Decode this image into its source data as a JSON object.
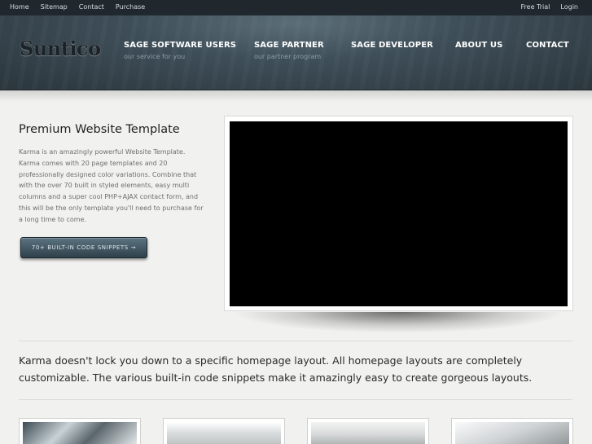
{
  "topbar": {
    "left_links": [
      "Home",
      "Sitemap",
      "Contact",
      "Purchase"
    ],
    "right_links": [
      "Free Trial",
      "Login"
    ]
  },
  "header": {
    "logo": "Suntico",
    "nav": [
      {
        "label": "SAGE SOFTWARE USERS",
        "sub": "our service for you"
      },
      {
        "label": "SAGE PARTNER",
        "sub": "our partner program"
      },
      {
        "label": "SAGE DEVELOPER",
        "sub": ""
      },
      {
        "label": "ABOUT US",
        "sub": ""
      },
      {
        "label": "CONTACT",
        "sub": ""
      }
    ]
  },
  "hero": {
    "title": "Premium Website Template",
    "body": "Karma is an amazingly powerful Website Template. Karma comes with 20 page templates and 20 professionally designed color variations. Combine that with the over 70 built in styled elements, easy multi columns and a super cool PHP+AJAX contact form, and this will be the only template you'll need to purchase for a long time to come.",
    "button_label": "70+ BUILT-IN CODE SNIPPETS →"
  },
  "tagline": "Karma doesn't lock you down to a specific homepage layout. All homepage layouts are completely customizable. The various built-in code snippets make it amazingly easy to create gorgeous layouts."
}
